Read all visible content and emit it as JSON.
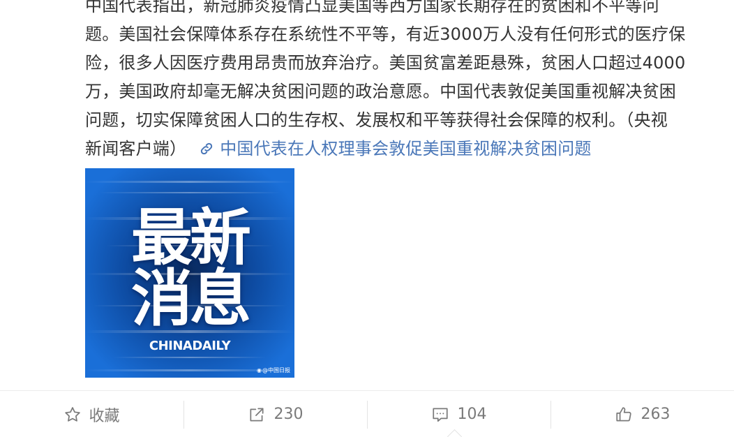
{
  "post": {
    "lines": [
      "中国代表指出，新冠肺炎疫情凸显美国等西方国家长期存在的贫困和不平等问",
      "题。美国社会保障体系存在系统性不平等，有近3000万人没有任何形式的医疗保",
      "险，很多人因医疗费用昂贵而放弃治疗。美国贫富差距悬殊，贫困人口超过4000",
      "万，美国政府却毫无解决贫困问题的政治意愿。中国代表敦促美国重视解决贫困",
      "问题，切实保障贫困人口的生存权、发展权和平等获得社会保障的权利。（央视"
    ],
    "last_line_text": "新闻客户端）",
    "link_icon": "link-icon",
    "link_text": "中国代表在人权理事会敦促美国重视解决贫困问题",
    "link_color": "#4a77b8"
  },
  "image": {
    "headline_line1": "最新",
    "headline_line2": "消息",
    "brand": "CHINADAILY",
    "watermark": "@中国日报",
    "watermark_icon": "weibo-icon",
    "background_color": "#0a3f86"
  },
  "actions": {
    "favorite": {
      "icon": "star-icon",
      "label": "收藏"
    },
    "repost": {
      "icon": "share-icon",
      "count": "230"
    },
    "comment": {
      "icon": "comment-icon",
      "count": "104"
    },
    "like": {
      "icon": "thumbs-up-icon",
      "count": "263"
    }
  }
}
